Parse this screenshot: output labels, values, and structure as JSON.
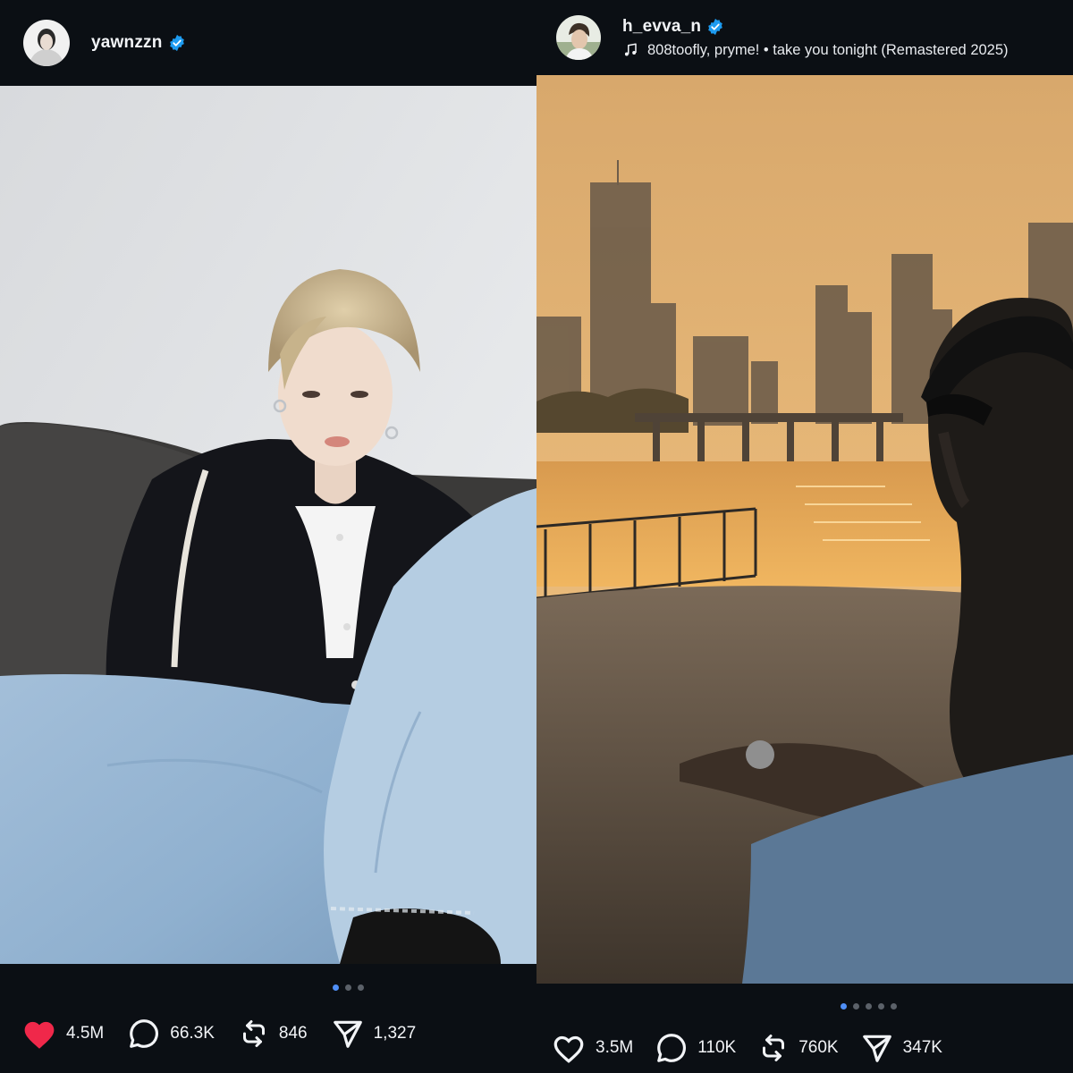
{
  "posts": [
    {
      "username": "yawnzzn",
      "verified": true,
      "carousel": {
        "count": 3,
        "active": 0
      },
      "stats": {
        "likes": "4.5M",
        "replies": "66.3K",
        "reposts": "846",
        "shares": "1,327"
      },
      "liked": true
    },
    {
      "username": "h_evva_n",
      "verified": true,
      "music": "808toofly, pryme! • take you tonight (Remastered 2025)",
      "carousel": {
        "count": 5,
        "active": 0
      },
      "stats": {
        "likes": "3.5M",
        "replies": "110K",
        "reposts": "760K",
        "shares": "347K"
      },
      "liked": false
    }
  ],
  "colors": {
    "background": "#0b0f14",
    "verified": "#1d9bf0",
    "like_active": "#f0284a",
    "dot_active": "#4f8ff7"
  },
  "icons": {
    "verified": "verified-badge-icon",
    "music": "music-note-icon",
    "like": "heart-icon",
    "reply": "speech-bubble-icon",
    "repost": "repost-icon",
    "share": "send-icon"
  }
}
